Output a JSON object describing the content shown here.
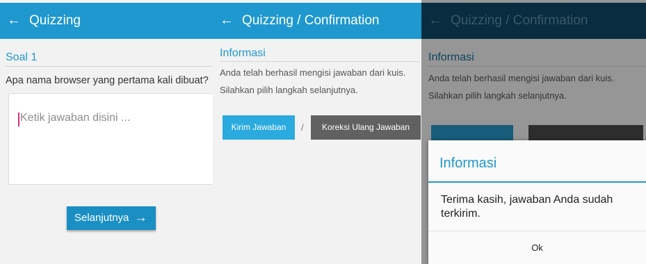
{
  "screens": {
    "question": {
      "app_bar": {
        "back_icon": "arrow-left-icon",
        "title": "Quizzing"
      },
      "section_title": "Soal 1",
      "question_text": "Apa nama browser yang pertama kali dibuat?",
      "answer_placeholder": "Ketik jawaban disini ...",
      "next_button": {
        "label": "Selanjutnya",
        "icon": "arrow-right-icon"
      }
    },
    "confirmation": {
      "app_bar": {
        "back_icon": "arrow-left-icon",
        "title": "Quizzing / Confirmation"
      },
      "section_title": "Informasi",
      "message_lines": [
        "Anda telah berhasil mengisi jawaban dari kuis.",
        "Silahkan pilih langkah selanjutnya."
      ],
      "send_button": "Kirim Jawaban",
      "separator": "/",
      "review_button": "Koreksi Ulang Jawaban"
    },
    "sent_dialog": {
      "app_bar": {
        "back_icon": "arrow-left-icon",
        "title": "Quizzing / Confirmation"
      },
      "section_title": "Informasi",
      "message_lines": [
        "Anda telah berhasil mengisi jawaban dari kuis.",
        "Silahkan pilih langkah selanjutnya."
      ],
      "dialog": {
        "title": "Informasi",
        "message": "Terima kasih, jawaban Anda sudah terkirim.",
        "ok_button": "Ok"
      }
    }
  },
  "colors": {
    "app_bar": "#1e98cf",
    "app_bar_dimmed": "#0d4a68",
    "accent": "#1e98cf",
    "send_button": "#2aaade",
    "review_button": "#616161",
    "cursor": "#d62e7a"
  }
}
